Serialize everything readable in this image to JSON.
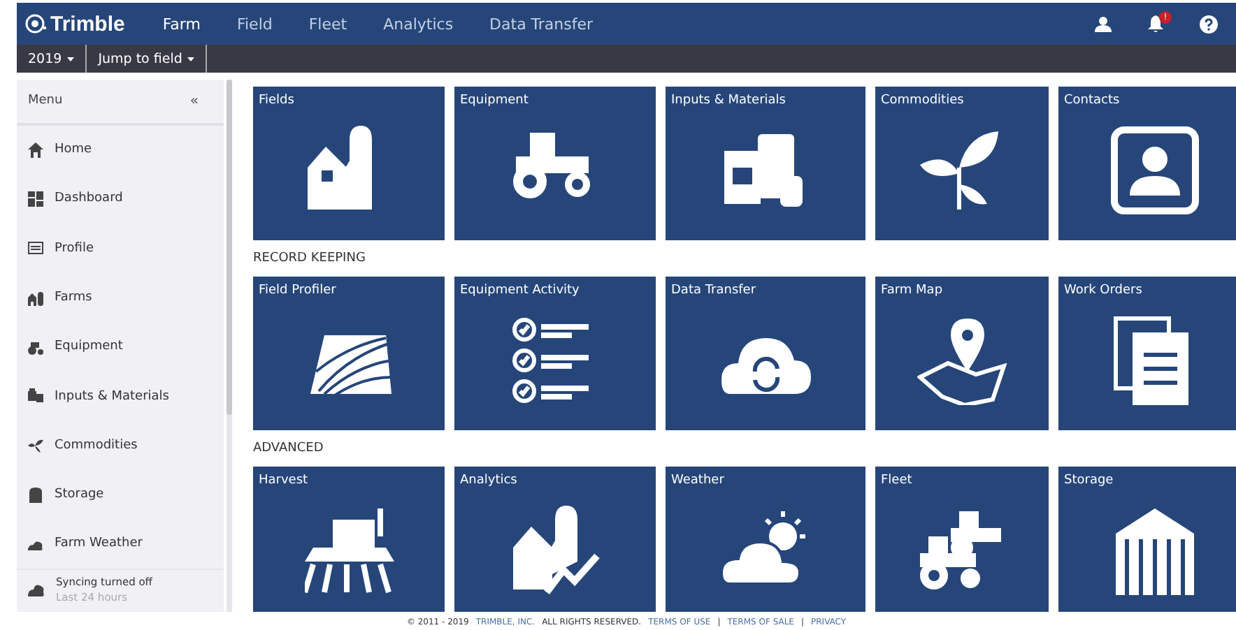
{
  "brand": "Trimble",
  "nav": [
    {
      "label": "Farm",
      "selected": true
    },
    {
      "label": "Field",
      "selected": false
    },
    {
      "label": "Fleet",
      "selected": false
    },
    {
      "label": "Analytics",
      "selected": false
    },
    {
      "label": "Data Transfer",
      "selected": false
    }
  ],
  "notification_badge": "!",
  "subbar": [
    {
      "label": "2019"
    },
    {
      "label": "Jump to field"
    }
  ],
  "sidebar": {
    "title": "Menu",
    "collapse": "«",
    "items": [
      {
        "label": "Home",
        "kind": "home"
      },
      {
        "label": "Dashboard",
        "kind": "dashboard"
      },
      {
        "label": "Profile",
        "kind": "profile"
      },
      {
        "label": "Farms",
        "kind": "farms"
      },
      {
        "label": "Equipment",
        "kind": "equipment"
      },
      {
        "label": "Inputs & Materials",
        "kind": "inputs"
      },
      {
        "label": "Commodities",
        "kind": "commodities"
      },
      {
        "label": "Storage",
        "kind": "storage"
      },
      {
        "label": "Farm Weather",
        "kind": "weather"
      }
    ],
    "sync": {
      "title": "Syncing turned off",
      "subtitle": "Last 24 hours"
    }
  },
  "sections": [
    {
      "tiles": [
        {
          "label": "Fields",
          "kind": "barn"
        },
        {
          "label": "Equipment",
          "kind": "tractor"
        },
        {
          "label": "Inputs & Materials",
          "kind": "inputs"
        },
        {
          "label": "Commodities",
          "kind": "plant"
        },
        {
          "label": "Contacts",
          "kind": "contact"
        }
      ]
    },
    {
      "heading": "RECORD KEEPING",
      "tiles": [
        {
          "label": "Field Profiler",
          "kind": "field"
        },
        {
          "label": "Equipment Activity",
          "kind": "checklist"
        },
        {
          "label": "Data Transfer",
          "kind": "cloud"
        },
        {
          "label": "Farm Map",
          "kind": "map"
        },
        {
          "label": "Work Orders",
          "kind": "docs"
        }
      ]
    },
    {
      "heading": "ADVANCED",
      "tiles": [
        {
          "label": "Harvest",
          "kind": "harvester"
        },
        {
          "label": "Analytics",
          "kind": "analytics"
        },
        {
          "label": "Weather",
          "kind": "weather"
        },
        {
          "label": "Fleet",
          "kind": "fleet"
        },
        {
          "label": "Storage",
          "kind": "silo"
        }
      ]
    }
  ],
  "footer": [
    {
      "text": "© 2011 - 2019",
      "kind": "text"
    },
    {
      "text": "TRIMBLE, INC.",
      "kind": "link"
    },
    {
      "text": "ALL RIGHTS RESERVED.",
      "kind": "text"
    },
    {
      "text": "TERMS OF USE",
      "kind": "link"
    },
    {
      "text": "|",
      "kind": "sep"
    },
    {
      "text": "TERMS OF SALE",
      "kind": "link"
    },
    {
      "text": "|",
      "kind": "sep"
    },
    {
      "text": "PRIVACY",
      "kind": "link"
    }
  ]
}
